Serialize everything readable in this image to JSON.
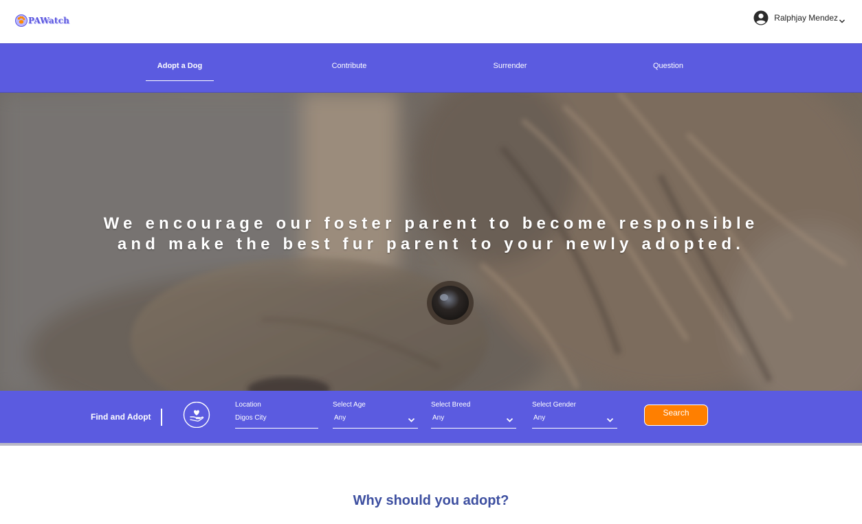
{
  "header": {
    "logo_text": "PAWatch",
    "user_name": "Ralphjay Mendez"
  },
  "nav": {
    "items": [
      {
        "label": "Adopt a Dog",
        "active": true
      },
      {
        "label": "Contribute",
        "active": false
      },
      {
        "label": "Surrender",
        "active": false
      },
      {
        "label": "Question",
        "active": false
      }
    ]
  },
  "hero": {
    "line1": "We encourage our foster parent to become responsible",
    "line2": "and make the best fur parent to your newly adopted."
  },
  "search": {
    "find_label": "Find and Adopt",
    "location": {
      "label": "Location",
      "value": "Digos City"
    },
    "age": {
      "label": "Select Age",
      "value": "Any"
    },
    "breed": {
      "label": "Select Breed",
      "value": "Any"
    },
    "gender": {
      "label": "Select Gender",
      "value": "Any"
    },
    "button_label": "Search"
  },
  "section": {
    "why_title": "Why should you adopt?"
  },
  "colors": {
    "brand": "#5b5be0",
    "accent": "#ff7f00",
    "heading": "#3d4fa0"
  },
  "icons": [
    "paw-logo-icon",
    "user-avatar-icon",
    "chevron-down-icon",
    "hand-heart-icon"
  ]
}
